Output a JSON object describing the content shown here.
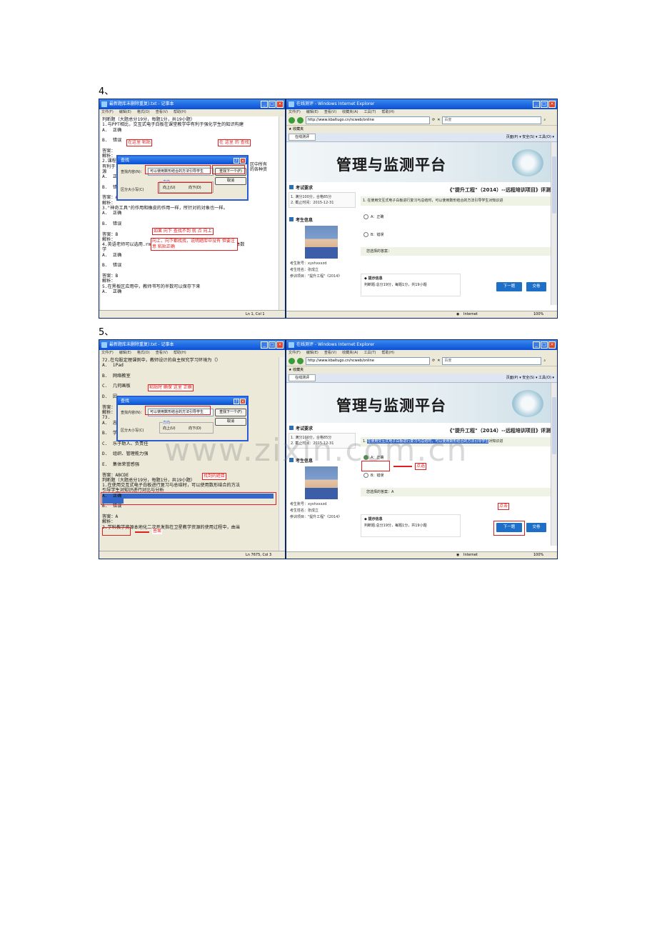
{
  "steps": [
    {
      "label": "4、",
      "notepad": {
        "title": "最新题库未删除重复).txt - 记事本",
        "menu": [
          "文件(F)",
          "编辑(E)",
          "格式(O)",
          "查看(V)",
          "帮助(H)"
        ],
        "text": "判断题（大题总分19分，每题1分，共19小题）\n1.与PPT相比，交互式电子白板在课堂教学中有利于强化学生的知识构建\nA.  正确\n\nB.  错误\n\n答案：\n解析：\n2.课程\n有利于\n源\nA.  正\n\nB.  错\n\n答案：A\n解析：\n3.\"神奇工具\"的作用和橡皮的作用一样，所针对的对象也一样。\nA.  正确\n\nB.  错误\n\n答案：B\n解析：\n4.英语老师可以选用.rm，.mp3，.mid，.wmv等这些音频格式的媒体数\n学\nA.  正确\n\nB.  错误\n\n答案：B\n解析：\n5.在黑板区应用中，教师书写的半数可以保存下来\nA.  正确",
        "side_text": "区中所有\n的各种资",
        "status": "Ln 1, Col 1"
      },
      "find": {
        "title": "查找",
        "label": "查找内容(N)：",
        "value": "可以使用数形结合的方法引导学生",
        "find_next": "查找下一个(F)",
        "cancel": "取消",
        "case": "区分大小写(C)",
        "direction": "方向",
        "up": "向上(U)",
        "down": "向下(D)"
      },
      "notes": {
        "paste": "在这里 粘贴",
        "click_find": "在 这里 的 查找",
        "not_found": "如果 向下 查找不到 就 点 向上",
        "warn": "向上，向下都找找，说明题库中没有 但要注意 粘贴正确"
      },
      "ie": {
        "title": "在线测评 - Windows Internet Explorer",
        "menu": [
          "文件(F)",
          "编辑(E)",
          "查看(V)",
          "收藏夹(A)",
          "工具(T)",
          "帮助(H)"
        ],
        "url": "http://www.kbaltugo.cn/ncweb/online",
        "search_placeholder": "百度",
        "favorites": "收藏夹",
        "tab": "在线测评",
        "tools": "页面(P) ▾  安全(S) ▾  工具(O) ▾",
        "platform_title": "管理与监测平台",
        "exam_section": "考试要求",
        "exam_line1": "1. 满分100分，合格85分",
        "exam_line2": "2. 截止时间：2015-12-31",
        "student_section": "考生信息",
        "account": "考生账号：xyshxxxzd",
        "name": "考生姓名：张成立",
        "project": "参训项目：\"提升工程\"《2014》",
        "page_title": "《\"提升工程\"（2014）--远程培训项目》评测",
        "question": "1. 在使用交互式电子白板进行复习与总结时，可以使用数形结合的方法引导学生对知识进",
        "option_a": "A：正确",
        "option_b": "B：错误",
        "your_answer": "您选择的答案：",
        "hint_title": "提示信息",
        "hint_text": "判断题:总分19分，每题1分，共19小题",
        "next": "下一题",
        "submit": "交卷",
        "status_zone": "Internet",
        "zoom": "100%"
      }
    },
    {
      "label": "5、",
      "notepad": {
        "title": "最新题库未删除重复).txt - 记事本",
        "menu": [
          "文件(F)",
          "编辑(E)",
          "格式(O)",
          "查看(V)",
          "帮助(H)"
        ],
        "text": "72.在勾股定理课例中，教师设计的自主探究学习环境为（）\nA.  iPad\n\nB.  网络教室\n\nC.  几何画板\n\nD.  因\n\n答案：\n解析：\n73.\nA.  志\n\nB.  学\n\nC.  乐于助人、负责任\n\nD.  组织、管理能力强\n\nE.  集体荣誉感强\n\n答案：ABCDE\n判断题（大题总分19分，每题1分，共19小题）\n1.在使用交互式电子白板进行复习与总结时，可以使用数形结合的方法\n引导学生对知识进行对比与分析\nA.  正确\n\nB.  错误\n\n答案：A\n解析：\n2.学科教学资源本地化二次开发指在卫星教学资源的使用过程中，由当",
        "side_text": "",
        "status": "Ln 7675, Col 3"
      },
      "find": {
        "title": "查找",
        "label": "查找内容(N)：",
        "value": "可以使用数形结合的方法引导学生",
        "find_next": "查找下一个(F)",
        "cancel": "取消",
        "case": "区分大小写(C)",
        "direction": "方向",
        "up": "向上(U)",
        "down": "向下(D)"
      },
      "notes": {
        "paste_ok": "粘贴时 确保 这里 正确",
        "found": "找到的题目",
        "answer": "答案",
        "select": "点选",
        "click": "点击"
      },
      "ie": {
        "title": "在线测评 - Windows Internet Explorer",
        "menu": [
          "文件(F)",
          "编辑(E)",
          "查看(V)",
          "收藏夹(A)",
          "工具(T)",
          "帮助(H)"
        ],
        "url": "http://www.kbaltugo.cn/ncweb/online",
        "search_placeholder": "百度",
        "favorites": "收藏夹",
        "tab": "在线测评",
        "tools": "页面(P) ▾  安全(S) ▾  工具(O) ▾",
        "platform_title": "管理与监测平台",
        "exam_section": "考试要求",
        "exam_line1": "1. 满分100分，合格85分",
        "exam_line2": "2. 截止时间：2015-12-31",
        "student_section": "考生信息",
        "account": "考生账号：xyshxxxzd",
        "name": "考生姓名：张成立",
        "project": "参训项目：\"提升工程\"《2014》",
        "page_title": "《\"提升工程\"（2014）--远程培训项目》评测",
        "question_hl": "在使用交互式电子白板进行复习与总结时，可以使用数形结合的方法引导学生",
        "question_rest": "对知识进",
        "option_a": "A：正确",
        "option_b": "B：错误",
        "your_answer": "您选择的答案：A",
        "hint_title": "提示信息",
        "hint_text": "判断题:总分19分，每题1分，共19小题",
        "next": "下一题",
        "submit": "交卷",
        "status_zone": "Internet",
        "zoom": "100%"
      }
    }
  ],
  "watermark": "www.zixin.com.cn"
}
